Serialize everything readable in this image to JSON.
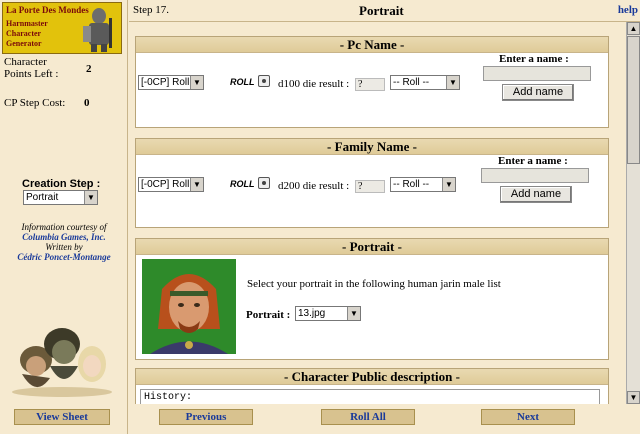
{
  "logo": {
    "line1": "La Porte Des Mondes",
    "line2": "Harnmaster",
    "line3": "Character",
    "line4": "Generator"
  },
  "sidebar": {
    "cp_left_label": "Character Points Left :",
    "cp_left_value": "2",
    "cp_step_label": "CP Step Cost:",
    "cp_step_value": "0",
    "creation_step_label": "Creation Step :",
    "creation_step_value": "Portrait",
    "courtesy_line1": "Information courtesy of",
    "courtesy_company": "Columbia Games, Inc.",
    "courtesy_line2": "Written by",
    "courtesy_author": "Cédric Poncet-Montange",
    "view_sheet": "View Sheet"
  },
  "header": {
    "step": "Step 17.",
    "title": "Portrait",
    "help": "help"
  },
  "pc_name": {
    "title": "- Pc Name -",
    "cost_select": "[-0CP] Roll",
    "roll_logo": "ROLL",
    "die_label": "d100 die result :",
    "die_result": "?",
    "roll_select": "-- Roll --",
    "enter_label": "Enter a name :",
    "input_value": "",
    "add_button": "Add name"
  },
  "family_name": {
    "title": "- Family Name -",
    "cost_select": "[-0CP] Roll",
    "roll_logo": "ROLL",
    "die_label": "d200 die result :",
    "die_result": "?",
    "roll_select": "-- Roll --",
    "enter_label": "Enter a name :",
    "input_value": "",
    "add_button": "Add name"
  },
  "portrait": {
    "title": "- Portrait -",
    "instruction": "Select your portrait in the following human jarin male list",
    "portrait_label": "Portrait :",
    "portrait_value": "13.jpg"
  },
  "description": {
    "title": "- Character Public description -",
    "history_value": "History:"
  },
  "footer": {
    "previous": "Previous",
    "roll_all": "Roll All",
    "next": "Next"
  }
}
